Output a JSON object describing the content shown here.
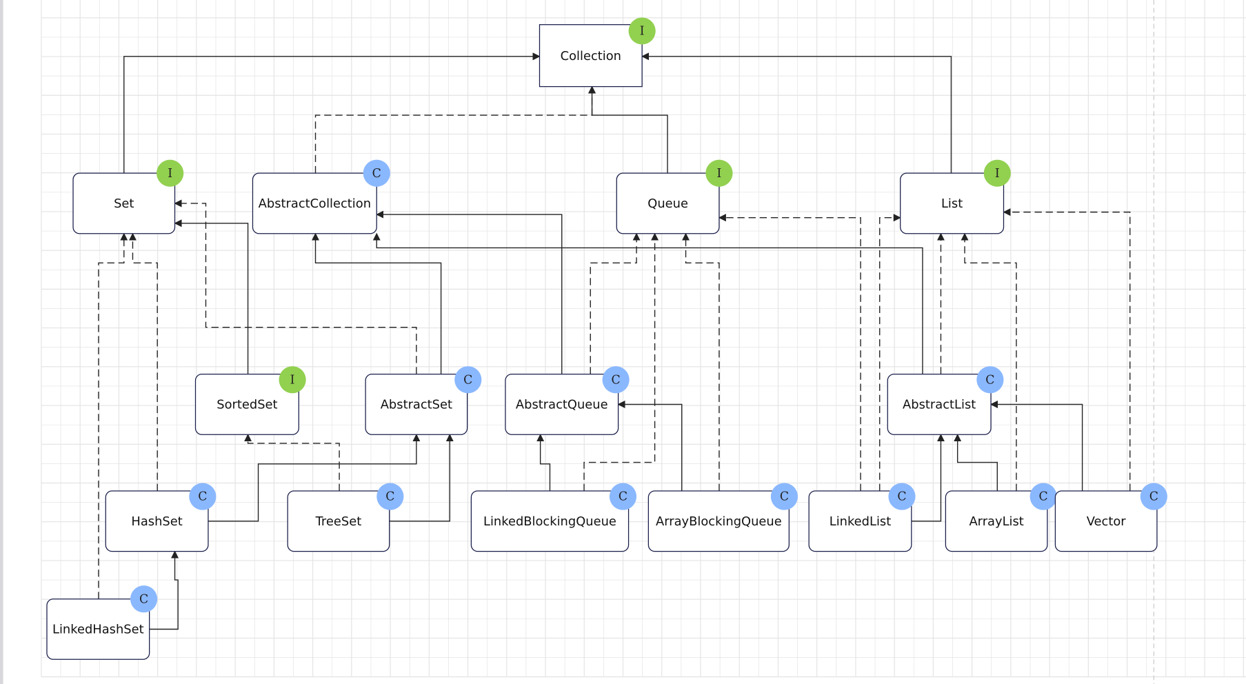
{
  "colors": {
    "interface_badge": "#92d050",
    "class_badge": "#8ab8ff",
    "border": "#1a1f4a",
    "grid": "#e3e3e3"
  },
  "nodes": [
    {
      "id": "collection",
      "label": "Collection",
      "badge": "I"
    },
    {
      "id": "set",
      "label": "Set",
      "badge": "I"
    },
    {
      "id": "abstractcollection",
      "label": "AbstractCollection",
      "badge": "C"
    },
    {
      "id": "queue",
      "label": "Queue",
      "badge": "I"
    },
    {
      "id": "list",
      "label": "List",
      "badge": "I"
    },
    {
      "id": "sortedset",
      "label": "SortedSet",
      "badge": "I"
    },
    {
      "id": "abstractset",
      "label": "AbstractSet",
      "badge": "C"
    },
    {
      "id": "abstractqueue",
      "label": "AbstractQueue",
      "badge": "C"
    },
    {
      "id": "abstractlist",
      "label": "AbstractList",
      "badge": "C"
    },
    {
      "id": "hashset",
      "label": "HashSet",
      "badge": "C"
    },
    {
      "id": "treeset",
      "label": "TreeSet",
      "badge": "C"
    },
    {
      "id": "linkedblockingqueue",
      "label": "LinkedBlockingQueue",
      "badge": "C"
    },
    {
      "id": "arrayblockingqueue",
      "label": "ArrayBlockingQueue",
      "badge": "C"
    },
    {
      "id": "linkedlist",
      "label": "LinkedList",
      "badge": "C"
    },
    {
      "id": "arraylist",
      "label": "ArrayList",
      "badge": "C"
    },
    {
      "id": "vector",
      "label": "Vector",
      "badge": "C"
    },
    {
      "id": "linkedhashset",
      "label": "LinkedHashSet",
      "badge": "C"
    }
  ],
  "edges": [
    {
      "from": "set",
      "to": "collection",
      "style": "solid"
    },
    {
      "from": "list",
      "to": "collection",
      "style": "solid"
    },
    {
      "from": "queue",
      "to": "collection",
      "style": "solid"
    },
    {
      "from": "abstractcollection",
      "to": "collection",
      "style": "dashed"
    },
    {
      "from": "sortedset",
      "to": "set",
      "style": "solid"
    },
    {
      "from": "abstractset",
      "to": "set",
      "style": "dashed"
    },
    {
      "from": "abstractset",
      "to": "abstractcollection",
      "style": "solid"
    },
    {
      "from": "abstractqueue",
      "to": "abstractcollection",
      "style": "solid"
    },
    {
      "from": "abstractlist",
      "to": "abstractcollection",
      "style": "solid"
    },
    {
      "from": "abstractqueue",
      "to": "queue",
      "style": "dashed"
    },
    {
      "from": "hashset",
      "to": "set",
      "style": "dashed"
    },
    {
      "from": "linkedhashset",
      "to": "set",
      "style": "dashed"
    },
    {
      "from": "hashset",
      "to": "abstractset",
      "style": "solid"
    },
    {
      "from": "treeset",
      "to": "abstractset",
      "style": "solid"
    },
    {
      "from": "treeset",
      "to": "sortedset",
      "style": "dashed"
    },
    {
      "from": "linkedhashset",
      "to": "hashset",
      "style": "solid"
    },
    {
      "from": "linkedblockingqueue",
      "to": "abstractqueue",
      "style": "solid"
    },
    {
      "from": "linkedblockingqueue",
      "to": "queue",
      "style": "dashed"
    },
    {
      "from": "arrayblockingqueue",
      "to": "abstractqueue",
      "style": "solid"
    },
    {
      "from": "arrayblockingqueue",
      "to": "queue",
      "style": "dashed"
    },
    {
      "from": "linkedlist",
      "to": "queue",
      "style": "dashed"
    },
    {
      "from": "linkedlist",
      "to": "list",
      "style": "dashed"
    },
    {
      "from": "linkedlist",
      "to": "abstractlist",
      "style": "solid"
    },
    {
      "from": "abstractlist",
      "to": "list",
      "style": "dashed"
    },
    {
      "from": "arraylist",
      "to": "abstractlist",
      "style": "solid"
    },
    {
      "from": "arraylist",
      "to": "list",
      "style": "dashed"
    },
    {
      "from": "vector",
      "to": "abstractlist",
      "style": "solid"
    },
    {
      "from": "vector",
      "to": "list",
      "style": "dashed"
    }
  ]
}
